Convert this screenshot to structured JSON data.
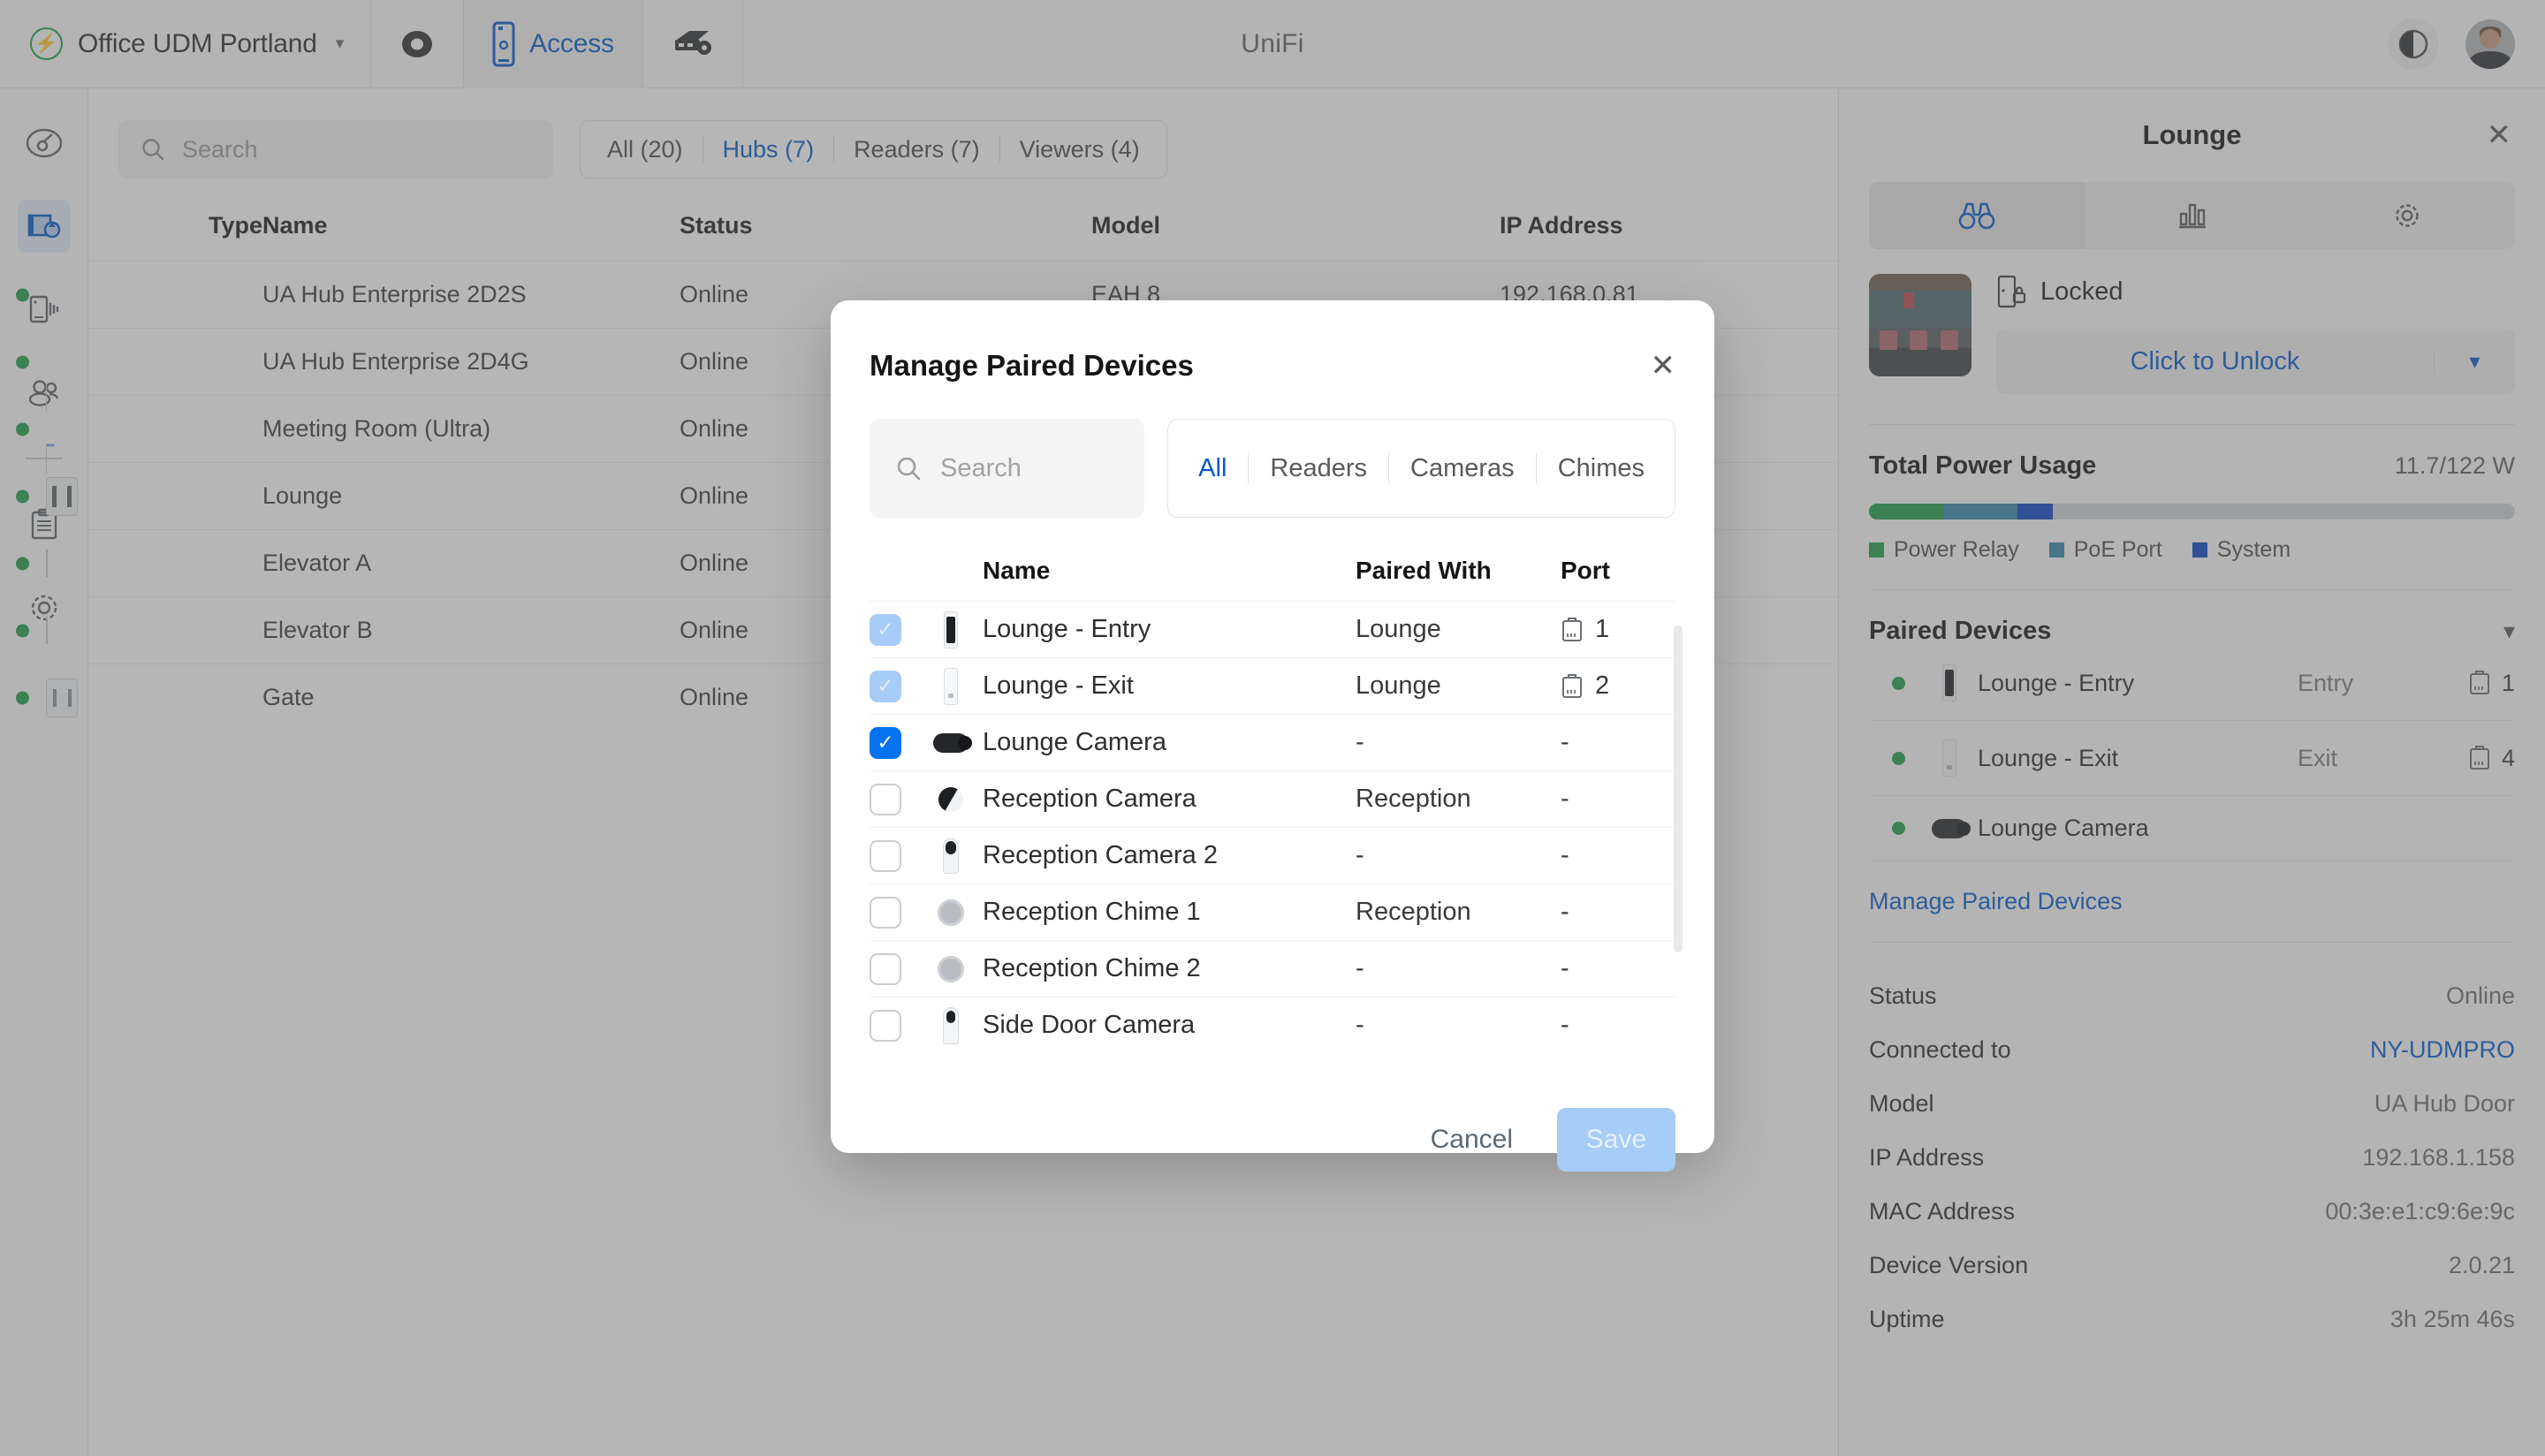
{
  "topbar": {
    "site_name": "Office UDM Portland",
    "brand": "UniFi",
    "apps": [
      {
        "name": "protect-app",
        "label": ""
      },
      {
        "name": "access-app",
        "label": "Access"
      },
      {
        "name": "network-app",
        "label": ""
      }
    ],
    "active_app_label": "Access",
    "theme_toggle": "contrast-icon",
    "avatar": "user-avatar"
  },
  "leftnav": {
    "items": [
      {
        "name": "dashboard",
        "icon": "speedometer-icon",
        "active": false
      },
      {
        "name": "devices",
        "icon": "door-hub-icon",
        "active": true
      },
      {
        "name": "readers",
        "icon": "reader-signal-icon",
        "active": false
      },
      {
        "name": "users",
        "icon": "users-icon",
        "active": false
      },
      {
        "name": "logs",
        "icon": "clipboard-icon",
        "active": false
      },
      {
        "name": "settings",
        "icon": "gear-icon",
        "active": false
      }
    ]
  },
  "main": {
    "search_placeholder": "Search",
    "filters": [
      {
        "label": "All (20)",
        "active": false
      },
      {
        "label": "Hubs (7)",
        "active": true
      },
      {
        "label": "Readers (7)",
        "active": false
      },
      {
        "label": "Viewers (4)",
        "active": false
      }
    ],
    "columns": [
      "Type",
      "Name",
      "Status",
      "Model",
      "IP Address"
    ],
    "rows": [
      {
        "name": "UA Hub Enterprise 2D2S",
        "status": "Online",
        "model": "EAH 8",
        "ip": "192.168.0.81",
        "icon": "hub-enterprise-icon"
      },
      {
        "name": "UA Hub Enterprise 2D4G",
        "status": "Online",
        "model": "",
        "ip": "",
        "icon": "hub-enterprise-icon"
      },
      {
        "name": "Meeting Room (Ultra)",
        "status": "Online",
        "model": "",
        "ip": "",
        "icon": "reader-ultra-icon"
      },
      {
        "name": "Lounge",
        "status": "Online",
        "model": "",
        "ip": "",
        "icon": "hub-door-icon"
      },
      {
        "name": "Elevator A",
        "status": "Online",
        "model": "",
        "ip": "",
        "icon": "elevator-hub-icon"
      },
      {
        "name": "Elevator B",
        "status": "Online",
        "model": "",
        "ip": "",
        "icon": "elevator-hub-icon"
      },
      {
        "name": "Gate",
        "status": "Online",
        "model": "",
        "ip": "",
        "icon": "gate-hub-icon"
      }
    ]
  },
  "right_panel": {
    "title": "Lounge",
    "close_icon": "close-icon",
    "tabs": [
      {
        "name": "overview",
        "icon": "binoculars-icon",
        "active": true
      },
      {
        "name": "insights",
        "icon": "bar-chart-icon",
        "active": false
      },
      {
        "name": "settings",
        "icon": "gear-icon",
        "active": false
      }
    ],
    "door": {
      "thumbnail": "lounge-photo",
      "lock_icon": "door-locked-icon",
      "lock_state": "Locked",
      "unlock_label": "Click to Unlock",
      "caret_icon": "chevron-down-icon"
    },
    "power": {
      "title": "Total Power Usage",
      "value": "11.7/122 W",
      "segments": [
        {
          "label": "Power Relay",
          "color": "#1f9d48",
          "pct": 11.5
        },
        {
          "label": "PoE Port",
          "color": "#3288ad",
          "pct": 11.5
        },
        {
          "label": "System",
          "color": "#0b43c2",
          "pct": 5.5
        }
      ],
      "track_color": "#cfd1d3"
    },
    "paired": {
      "title": "Paired Devices",
      "caret_icon": "chevron-down-icon",
      "manage_link": "Manage Paired Devices",
      "items": [
        {
          "name": "Lounge - Entry",
          "role": "Entry",
          "port": "1",
          "icon": "reader-dark-icon",
          "online": true
        },
        {
          "name": "Lounge - Exit",
          "role": "Exit",
          "port": "4",
          "icon": "reader-light-icon",
          "online": true
        },
        {
          "name": "Lounge Camera",
          "role": "",
          "port": "",
          "icon": "camera-bullet-icon",
          "online": true
        }
      ]
    },
    "details": [
      {
        "key": "Status",
        "value": "Online",
        "link": false
      },
      {
        "key": "Connected to",
        "value": "NY-UDMPRO",
        "link": true
      },
      {
        "key": "Model",
        "value": "UA Hub Door",
        "link": false
      },
      {
        "key": "IP Address",
        "value": "192.168.1.158",
        "link": false
      },
      {
        "key": "MAC Address",
        "value": "00:3e:e1:c9:6e:9c",
        "link": false
      },
      {
        "key": "Device Version",
        "value": "2.0.21",
        "link": false
      },
      {
        "key": "Uptime",
        "value": "3h 25m 46s",
        "link": false
      }
    ]
  },
  "modal": {
    "title": "Manage Paired Devices",
    "close_icon": "close-icon",
    "search_placeholder": "Search",
    "chips": [
      {
        "label": "All",
        "active": true
      },
      {
        "label": "Readers",
        "active": false
      },
      {
        "label": "Cameras",
        "active": false
      },
      {
        "label": "Chimes",
        "active": false
      }
    ],
    "columns": {
      "name": "Name",
      "paired_with": "Paired With",
      "port": "Port"
    },
    "rows": [
      {
        "name": "Lounge - Entry",
        "paired_with": "Lounge",
        "port": "1",
        "checked": true,
        "locked": true,
        "icon": "reader-dark-icon"
      },
      {
        "name": "Lounge - Exit",
        "paired_with": "Lounge",
        "port": "2",
        "checked": true,
        "locked": true,
        "icon": "reader-light-icon"
      },
      {
        "name": "Lounge Camera",
        "paired_with": "-",
        "port": "-",
        "checked": true,
        "locked": false,
        "icon": "camera-bullet-icon"
      },
      {
        "name": "Reception Camera",
        "paired_with": "Reception",
        "port": "-",
        "checked": false,
        "locked": false,
        "icon": "camera-dome-icon"
      },
      {
        "name": "Reception Camera 2",
        "paired_with": "-",
        "port": "-",
        "checked": false,
        "locked": false,
        "icon": "camera-stand-icon"
      },
      {
        "name": "Reception Chime 1",
        "paired_with": "Reception",
        "port": "-",
        "checked": false,
        "locked": false,
        "icon": "chime-icon"
      },
      {
        "name": "Reception Chime 2",
        "paired_with": "-",
        "port": "-",
        "checked": false,
        "locked": false,
        "icon": "chime-icon"
      },
      {
        "name": "Side Door Camera",
        "paired_with": "-",
        "port": "-",
        "checked": false,
        "locked": false,
        "icon": "camera-tower-icon"
      }
    ],
    "cancel_label": "Cancel",
    "save_label": "Save",
    "save_enabled": false
  },
  "colors": {
    "accent": "#0559c9",
    "accent_bright": "#0573f0",
    "accent_muted": "#a6ccf7",
    "online": "#1f9d48"
  }
}
